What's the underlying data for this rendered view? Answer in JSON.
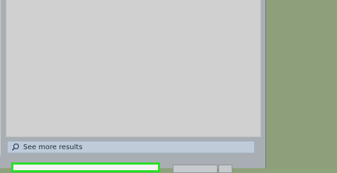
{
  "start_menu": {
    "see_more_results": "See more results",
    "see_more_icon": "search-icon",
    "search": {
      "placeholder": "",
      "value": "",
      "highlight_color": "#26e026"
    },
    "shutdown_button": {
      "label": "",
      "arrow_icon": "chevron-right-icon"
    }
  },
  "desktop": {
    "background_color": "#8da07b"
  }
}
